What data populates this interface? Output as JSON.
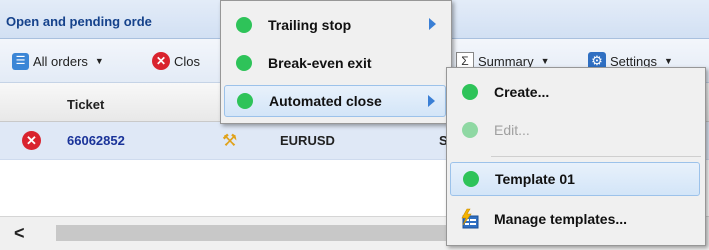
{
  "panel": {
    "title": "Open and pending orde"
  },
  "toolbar": {
    "all_orders": "All orders",
    "close": "Clos",
    "summary": "Summary",
    "settings": "Settings"
  },
  "grid": {
    "columns": {
      "ticket": "Ticket"
    },
    "rows": [
      {
        "ticket": "66062852",
        "symbol": "EURUSD",
        "side": "S"
      }
    ]
  },
  "menu1": {
    "items": [
      {
        "label": "Trailing stop",
        "has_submenu": true
      },
      {
        "label": "Break-even exit",
        "has_submenu": false
      },
      {
        "label": "Automated close",
        "has_submenu": true,
        "active": true
      }
    ]
  },
  "menu2": {
    "items": [
      {
        "label": "Create...",
        "enabled": true
      },
      {
        "label": "Edit...",
        "enabled": false
      },
      {
        "label": "Template 01",
        "enabled": true,
        "active": true
      },
      {
        "label": "Manage templates...",
        "enabled": true
      }
    ]
  },
  "icons": {
    "status_dot": "green-circle-icon",
    "submenu_arrow": "triangle-right-icon",
    "row_close": "red-close-circle-icon",
    "row_tool": "tools-icon",
    "manage_templates": "template-manager-icon"
  },
  "colors": {
    "accent": "#3a7fd5",
    "status_green": "#2ec359",
    "close_red": "#d9232e",
    "ticket_blue": "#1a3399"
  }
}
